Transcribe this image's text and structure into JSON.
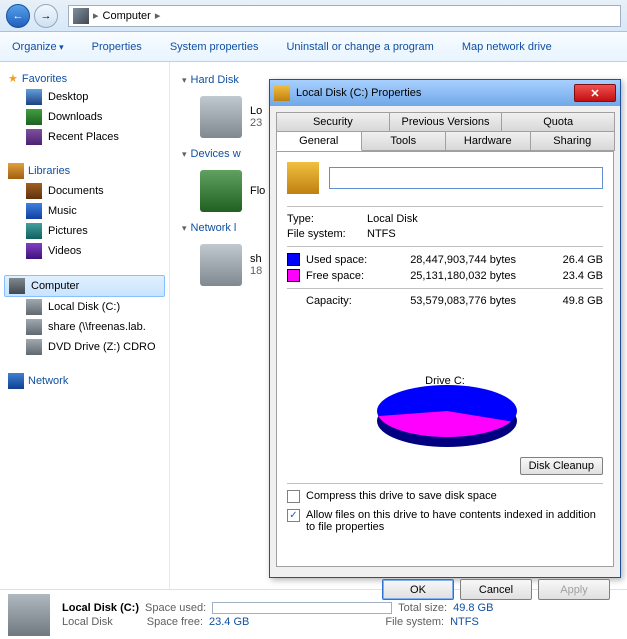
{
  "nav": {
    "location": "Computer"
  },
  "toolbar": {
    "organize": "Organize",
    "properties": "Properties",
    "system_properties": "System properties",
    "uninstall": "Uninstall or change a program",
    "map_drive": "Map network drive"
  },
  "sidebar": {
    "favorites": {
      "label": "Favorites",
      "items": [
        "Desktop",
        "Downloads",
        "Recent Places"
      ]
    },
    "libraries": {
      "label": "Libraries",
      "items": [
        "Documents",
        "Music",
        "Pictures",
        "Videos"
      ]
    },
    "computer": {
      "label": "Computer",
      "items": [
        "Local Disk (C:)",
        "share (\\\\freenas.lab.",
        "DVD Drive (Z:) CDRO"
      ]
    },
    "network": {
      "label": "Network"
    }
  },
  "content": {
    "cat_hdd": "Hard Disk",
    "drive1_label": "Lo",
    "drive1_sub": "23",
    "cat_dev": "Devices w",
    "drive2_label": "Flo",
    "cat_net": "Network l",
    "drive3_label": "sh",
    "drive3_sub": "18"
  },
  "status": {
    "title": "Local Disk (C:)",
    "subtitle": "Local Disk",
    "space_used_label": "Space used:",
    "space_free_label": "Space free:",
    "space_free_val": "23.4 GB",
    "total_label": "Total size:",
    "total_val": "49.8 GB",
    "fs_label": "File system:",
    "fs_val": "NTFS"
  },
  "dialog": {
    "title": "Local Disk (C:) Properties",
    "tabs_top": [
      "Security",
      "Previous Versions",
      "Quota"
    ],
    "tabs_bottom": [
      "General",
      "Tools",
      "Hardware",
      "Sharing"
    ],
    "volume_name": "",
    "type_label": "Type:",
    "type_val": "Local Disk",
    "fs_label": "File system:",
    "fs_val": "NTFS",
    "used_label": "Used space:",
    "used_bytes": "28,447,903,744 bytes",
    "used_gb": "26.4 GB",
    "free_label": "Free space:",
    "free_bytes": "25,131,180,032 bytes",
    "free_gb": "23.4 GB",
    "cap_label": "Capacity:",
    "cap_bytes": "53,579,083,776 bytes",
    "cap_gb": "49.8 GB",
    "drive_letter": "Drive C:",
    "cleanup": "Disk Cleanup",
    "compress": "Compress this drive to save disk space",
    "index": "Allow files on this drive to have contents indexed in addition to file properties",
    "ok": "OK",
    "cancel": "Cancel",
    "apply": "Apply"
  },
  "chart_data": {
    "type": "pie",
    "title": "Drive C:",
    "series": [
      {
        "name": "Used space",
        "value": 28447903744,
        "gb": 26.4,
        "color": "#0000ff"
      },
      {
        "name": "Free space",
        "value": 25131180032,
        "gb": 23.4,
        "color": "#ff00ff"
      }
    ],
    "total": {
      "name": "Capacity",
      "value": 53579083776,
      "gb": 49.8
    }
  }
}
